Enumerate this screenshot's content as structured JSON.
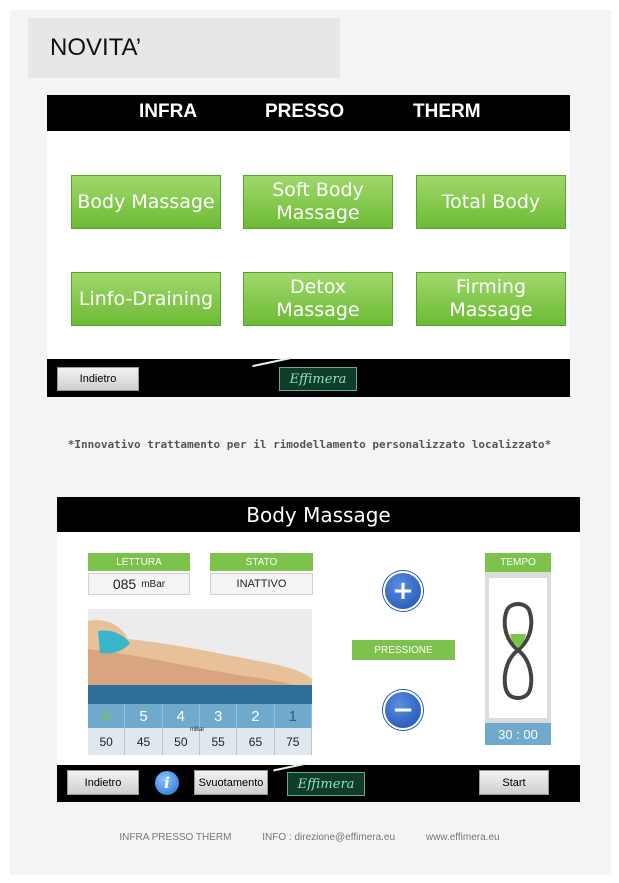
{
  "header": {
    "title": "NOVITA’"
  },
  "screen1": {
    "tabs": [
      "INFRA",
      "PRESSO",
      "THERM"
    ],
    "programs": [
      "Body Massage",
      "Soft Body\nMassage",
      "Total Body",
      "Linfo-Draining",
      "Detox\nMassage",
      "Firming\nMassage"
    ],
    "back_label": "Indietro",
    "logo": "Effimera"
  },
  "caption": "*Innovativo trattamento per il rimodellamento personalizzato localizzato*",
  "screen2": {
    "title": "Body Massage",
    "lettura_label": "LETTURA",
    "lettura_value": "085",
    "lettura_unit": "mBar",
    "stato_label": "STATO",
    "stato_value": "INATTIVO",
    "pressione_label": "PRESSIONE",
    "plus": "+",
    "minus": "−",
    "tempo_label": "TEMPO",
    "tempo_value": "30 : 00",
    "zones": [
      "6",
      "5",
      "4",
      "3",
      "2",
      "1"
    ],
    "pressures": [
      "50",
      "45",
      "50",
      "55",
      "65",
      "75"
    ],
    "pressure_unit": "mBar",
    "back_label": "Indietro",
    "info_icon": "i",
    "empty_label": "Svuotamento",
    "start_label": "Start",
    "logo": "Effimera"
  },
  "footer": {
    "brand": "INFRA PRESSO THERM",
    "info": "INFO : direzione@effimera.eu",
    "site": "www.effimera.eu"
  },
  "colors": {
    "green": "#7cc24b",
    "blue_btn": "#1d4fb0",
    "zone_blue": "#6fa9cc"
  }
}
